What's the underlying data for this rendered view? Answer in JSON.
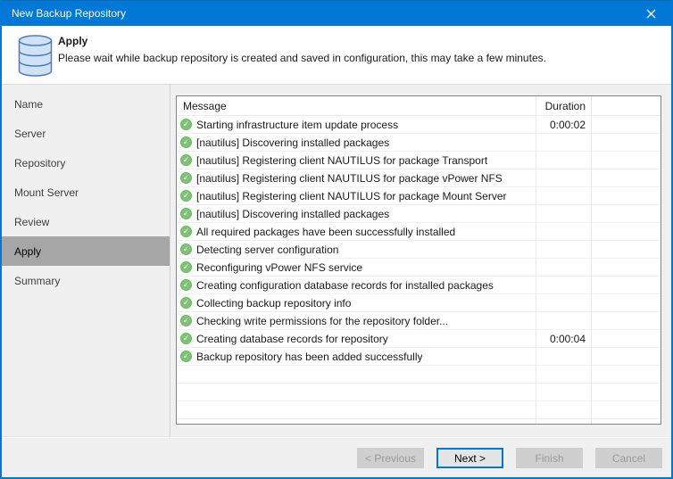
{
  "window": {
    "title": "New Backup Repository",
    "accent_color": "#0078d7"
  },
  "header": {
    "title": "Apply",
    "description": "Please wait while backup repository is created and saved in configuration, this may take a few minutes.",
    "icon": "database-icon"
  },
  "sidebar": {
    "items": [
      "Name",
      "Server",
      "Repository",
      "Mount Server",
      "Review",
      "Apply",
      "Summary"
    ],
    "selected_index": 5,
    "selected_label": "Apply",
    "selected_bg_color": "#a6a6a6"
  },
  "table": {
    "columns": [
      "Message",
      "Duration"
    ],
    "status_icon": "success-check-icon",
    "status_color": "#7cc474",
    "rows": [
      {
        "message": "Starting infrastructure item update process",
        "duration": "0:00:02"
      },
      {
        "message": "[nautilus] Discovering installed packages",
        "duration": ""
      },
      {
        "message": "[nautilus] Registering client NAUTILUS for package Transport",
        "duration": ""
      },
      {
        "message": "[nautilus] Registering client NAUTILUS for package vPower NFS",
        "duration": ""
      },
      {
        "message": "[nautilus] Registering client NAUTILUS for package Mount Server",
        "duration": ""
      },
      {
        "message": "[nautilus] Discovering installed packages",
        "duration": ""
      },
      {
        "message": "All required packages have been successfully installed",
        "duration": ""
      },
      {
        "message": "Detecting server configuration",
        "duration": ""
      },
      {
        "message": "Reconfiguring vPower NFS service",
        "duration": ""
      },
      {
        "message": "Creating configuration database records for installed packages",
        "duration": ""
      },
      {
        "message": "Collecting backup repository info",
        "duration": ""
      },
      {
        "message": "Checking write permissions for the repository folder...",
        "duration": ""
      },
      {
        "message": "Creating database records for repository",
        "duration": "0:00:04"
      },
      {
        "message": "Backup repository has been added successfully",
        "duration": ""
      }
    ],
    "empty_row_count": 4
  },
  "buttons": {
    "previous": "< Previous",
    "next": "Next >",
    "finish": "Finish",
    "cancel": "Cancel"
  }
}
